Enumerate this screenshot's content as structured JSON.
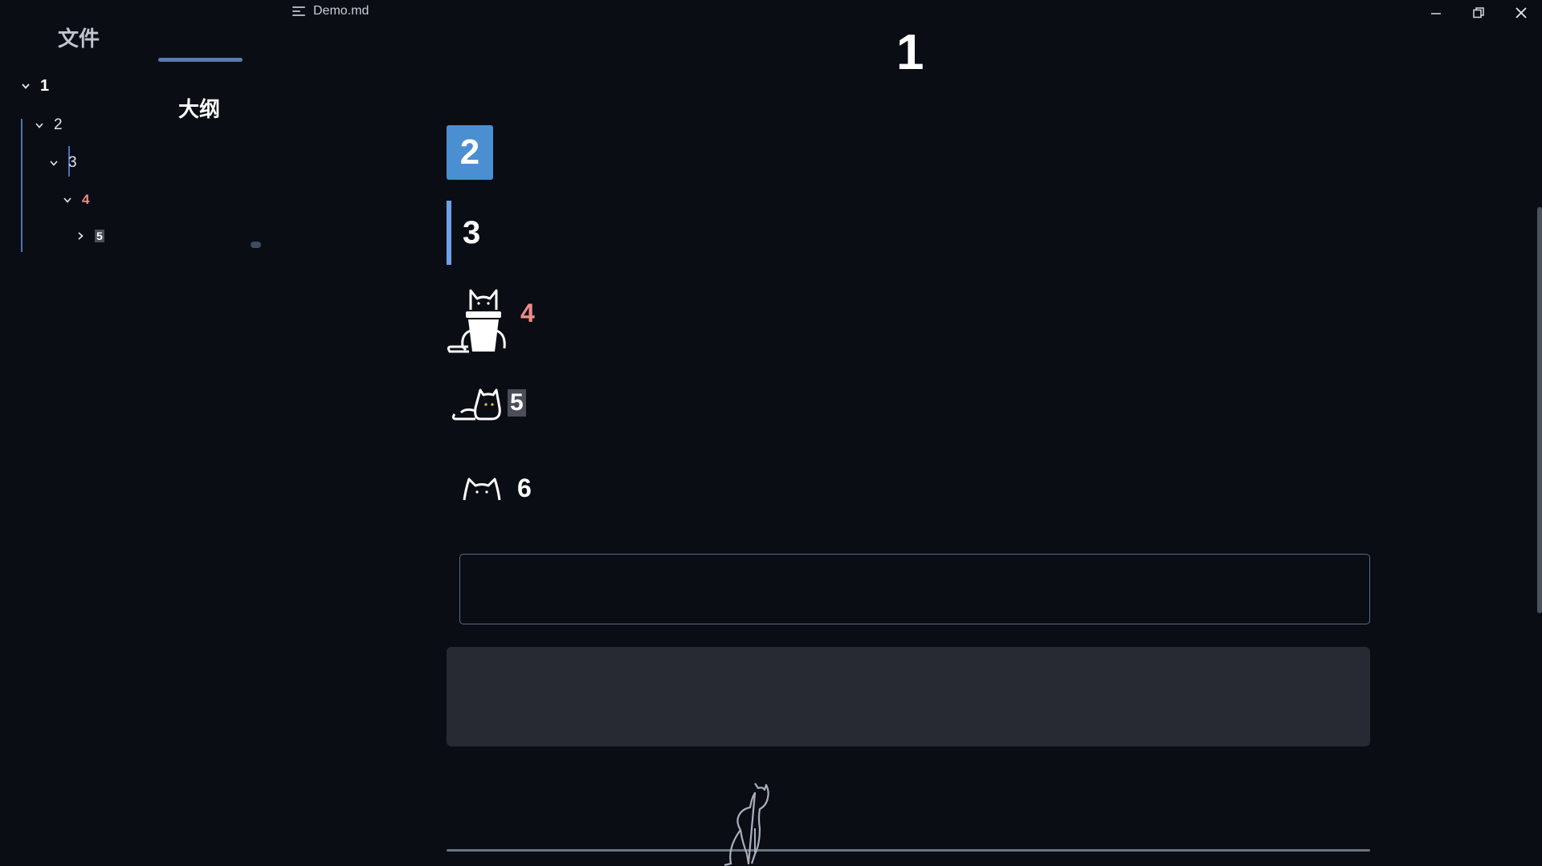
{
  "window": {
    "title": "Demo.md",
    "controls": [
      "minimize",
      "restore",
      "close"
    ]
  },
  "sidebar": {
    "tabs": [
      {
        "label": "文件",
        "active": false
      },
      {
        "label": "大纲",
        "active": true
      }
    ],
    "outline": [
      {
        "level": 1,
        "label": "1",
        "expanded": true
      },
      {
        "level": 2,
        "label": "2",
        "expanded": true
      },
      {
        "level": 3,
        "label": "3",
        "expanded": true
      },
      {
        "level": 4,
        "label": "4",
        "expanded": true
      },
      {
        "level": 5,
        "label": "5",
        "expanded": false
      }
    ]
  },
  "document": {
    "h1": "1",
    "h2": "2",
    "h3": "3",
    "h4": "4",
    "h5": "5",
    "h6": "6",
    "input_value": "",
    "code_block": ""
  },
  "colors": {
    "background": "#0a0d14",
    "accent_blue": "#4a8fd1",
    "h3_bar": "#6da2e8",
    "h4_red": "#f08a8a",
    "tab_underline": "#5a7ab2",
    "code_bg": "#272a32"
  },
  "icons": [
    "menu-icon",
    "minimize-icon",
    "restore-icon",
    "close-icon",
    "chevron-down-icon",
    "chevron-right-icon",
    "cat-in-cup-icon",
    "lying-cat-icon",
    "cat-ears-icon",
    "sitting-cat-icon"
  ]
}
